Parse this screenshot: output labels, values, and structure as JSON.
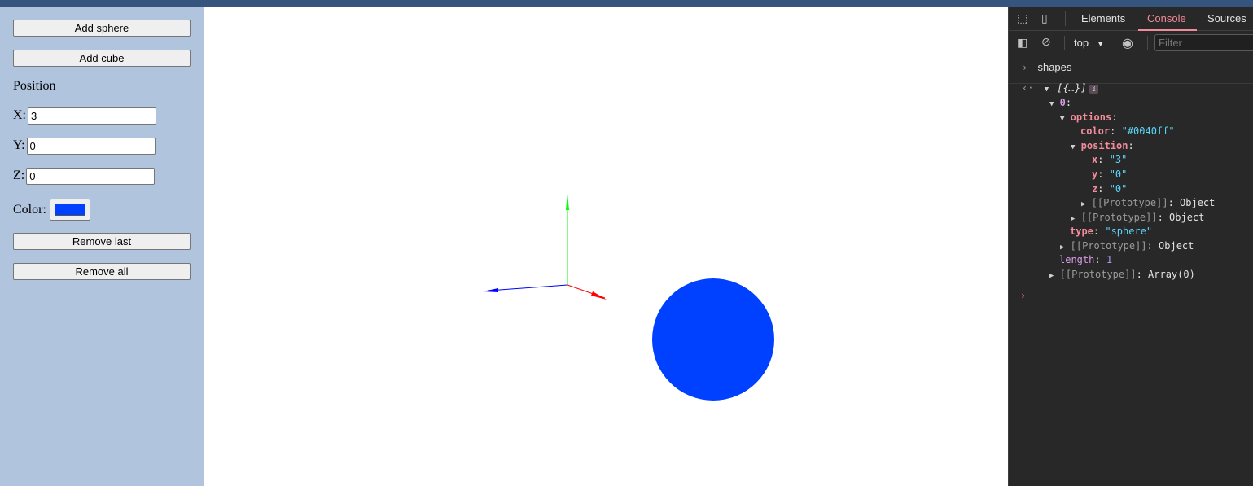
{
  "panel": {
    "add_sphere": "Add sphere",
    "add_cube": "Add cube",
    "position_heading": "Position",
    "x_label": "X:",
    "x_value": "3",
    "y_label": "Y:",
    "y_value": "0",
    "z_label": "Z:",
    "z_value": "0",
    "color_label": "Color:",
    "color_value": "#0040ff",
    "remove_last": "Remove last",
    "remove_all": "Remove all"
  },
  "scene": {
    "axis_colors": {
      "x": "#ff0000",
      "y": "#00ff00",
      "z": "#0000ff"
    },
    "sphere_color": "#0040ff"
  },
  "devtools": {
    "tabs": [
      "Elements",
      "Console",
      "Sources"
    ],
    "active_tab": "Console",
    "context": "top",
    "filter_placeholder": "Filter",
    "console": {
      "input": "shapes",
      "array_summary": "[{…}]",
      "index": "0",
      "options_key": "options",
      "color_key": "color",
      "color_val": "\"#0040ff\"",
      "position_key": "position",
      "x_key": "x",
      "x_val": "\"3\"",
      "y_key": "y",
      "y_val": "\"0\"",
      "z_key": "z",
      "z_val": "\"0\"",
      "proto_key": "[[Prototype]]",
      "proto_obj": "Object",
      "type_key": "type",
      "type_val": "\"sphere\"",
      "length_key": "length",
      "length_val": "1",
      "proto_array": "Array(0)"
    }
  }
}
